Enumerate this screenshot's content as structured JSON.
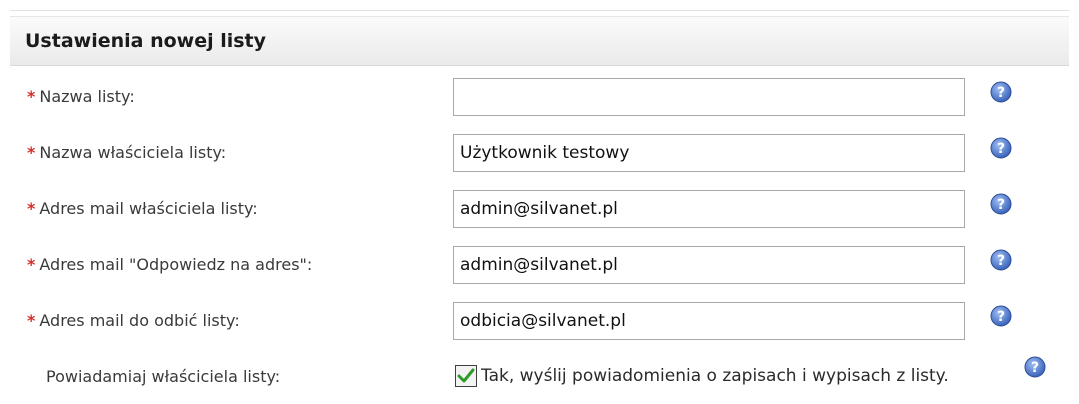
{
  "panel": {
    "title": "Ustawienia nowej listy"
  },
  "form": {
    "required_marker": "*",
    "fields": [
      {
        "label": "Nazwa listy:",
        "value": ""
      },
      {
        "label": "Nazwa właściciela listy:",
        "value": "Użytkownik testowy"
      },
      {
        "label": "Adres mail właściciela listy:",
        "value": "admin@silvanet.pl"
      },
      {
        "label": "Adres mail \"Odpowiedz na adres\":",
        "value": "admin@silvanet.pl"
      },
      {
        "label": "Adres mail do odbić listy:",
        "value": "odbicia@silvanet.pl"
      }
    ],
    "notify": {
      "label": "Powiadamiaj właściciela listy:",
      "checkbox_label": "Tak, wyślij powiadomienia o zapisach i wypisach z listy.",
      "checked": true
    }
  },
  "icons": {
    "help": "question-mark-help-icon",
    "check": "checkmark-icon"
  },
  "colors": {
    "required": "#d0312d",
    "help_blue": "#4b74c6",
    "check_green": "#2f9a2a"
  }
}
